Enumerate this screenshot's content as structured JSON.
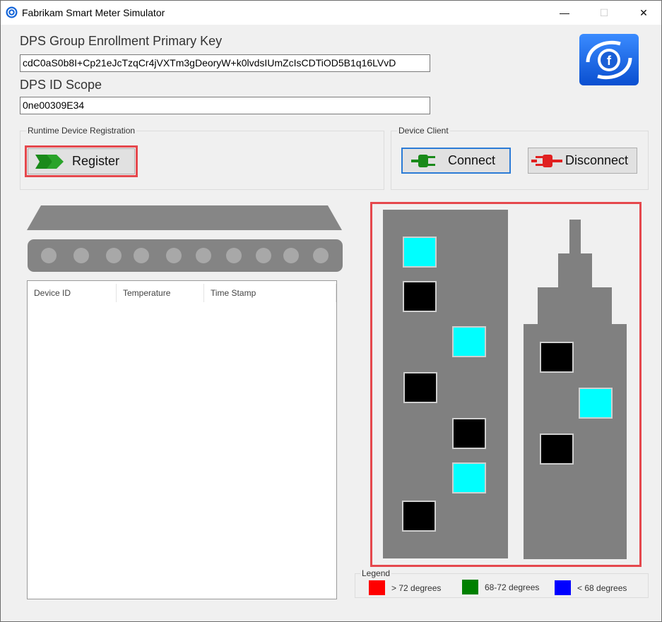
{
  "window": {
    "title": "Fabrikam Smart Meter Simulator",
    "controls": {
      "minimize": "—",
      "maximize": "☐",
      "close": "✕"
    }
  },
  "enrollment": {
    "primary_key_label": "DPS Group Enrollment Primary Key",
    "primary_key_value": "cdC0aS0b8I+Cp21eJcTzqCr4jVXTm3gDeoryW+k0lvdsIUmZcIsCDTiOD5B1q16LVvD",
    "id_scope_label": "DPS ID Scope",
    "id_scope_value": "0ne00309E34"
  },
  "registration": {
    "group_label": "Runtime Device Registration",
    "register_label": "Register"
  },
  "device_client": {
    "group_label": "Device Client",
    "connect_label": "Connect",
    "disconnect_label": "Disconnect"
  },
  "table": {
    "columns": [
      "Device ID",
      "Temperature",
      "Time Stamp"
    ],
    "rows": []
  },
  "building_1": {
    "windows": [
      {
        "state": "cyan"
      },
      {
        "state": "black"
      },
      {
        "state": "cyan"
      },
      {
        "state": "black"
      },
      {
        "state": "black"
      },
      {
        "state": "cyan"
      },
      {
        "state": "black"
      }
    ]
  },
  "building_2": {
    "windows": [
      {
        "state": "black"
      },
      {
        "state": "cyan"
      },
      {
        "state": "black"
      }
    ]
  },
  "legend": {
    "title": "Legend",
    "items": [
      {
        "label": "> 72 degrees",
        "color": "#ff0000"
      },
      {
        "label": "68-72 degrees",
        "color": "#008000"
      },
      {
        "label": "< 68 degrees",
        "color": "#0000ff"
      }
    ]
  },
  "colors": {
    "highlight_outline": "#e5484d",
    "building_gray": "#808080",
    "window_cyan": "#00ffff",
    "window_black": "#000000"
  }
}
